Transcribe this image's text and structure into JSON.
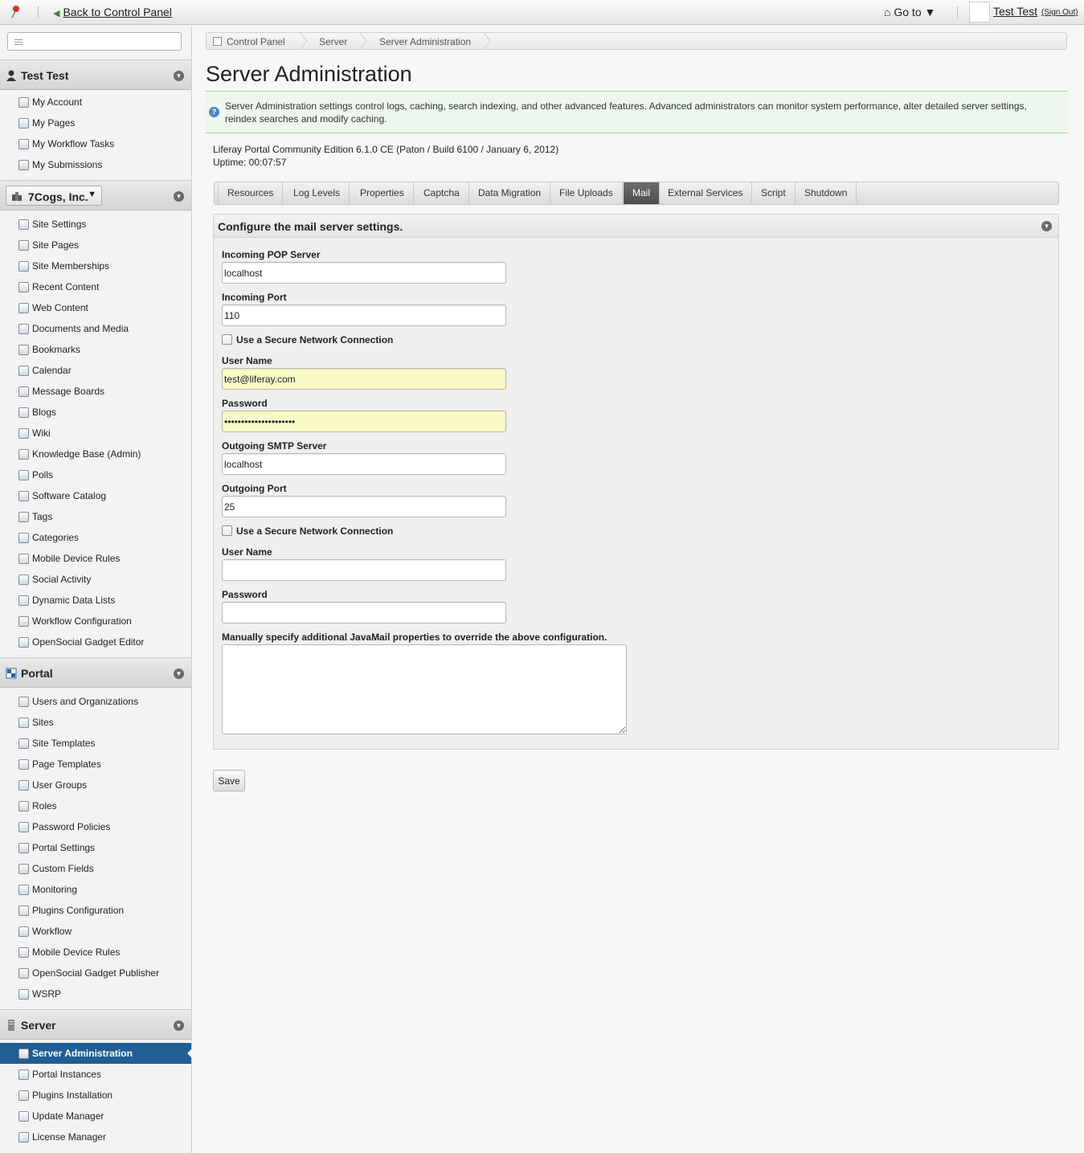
{
  "dockbar": {
    "back_label": "Back to Control Panel",
    "goto_label": "Go to",
    "user_name": "Test Test",
    "sign_out": "(Sign Out)"
  },
  "sidebar": {
    "search_value": "",
    "user_panel": {
      "title": "Test Test",
      "items": [
        "My Account",
        "My Pages",
        "My Workflow Tasks",
        "My Submissions"
      ]
    },
    "site_panel": {
      "site_name": "7Cogs, Inc.",
      "items": [
        "Site Settings",
        "Site Pages",
        "Site Memberships",
        "Recent Content",
        "Web Content",
        "Documents and Media",
        "Bookmarks",
        "Calendar",
        "Message Boards",
        "Blogs",
        "Wiki",
        "Knowledge Base (Admin)",
        "Polls",
        "Software Catalog",
        "Tags",
        "Categories",
        "Mobile Device Rules",
        "Social Activity",
        "Dynamic Data Lists",
        "Workflow Configuration",
        "OpenSocial Gadget Editor"
      ]
    },
    "portal_panel": {
      "title": "Portal",
      "items": [
        "Users and Organizations",
        "Sites",
        "Site Templates",
        "Page Templates",
        "User Groups",
        "Roles",
        "Password Policies",
        "Portal Settings",
        "Custom Fields",
        "Monitoring",
        "Plugins Configuration",
        "Workflow",
        "Mobile Device Rules",
        "OpenSocial Gadget Publisher",
        "WSRP"
      ]
    },
    "server_panel": {
      "title": "Server",
      "items": [
        "Server Administration",
        "Portal Instances",
        "Plugins Installation",
        "Update Manager",
        "License Manager"
      ],
      "active_index": 0
    }
  },
  "breadcrumb": [
    "Control Panel",
    "Server",
    "Server Administration"
  ],
  "page_title": "Server Administration",
  "info_text": "Server Administration settings control logs, caching, search indexing, and other advanced features. Advanced administrators can monitor system performance, alter detailed server settings, reindex searches and modify caching.",
  "version_line": "Liferay Portal Community Edition 6.1.0 CE (Paton / Build 6100 / January 6, 2012)",
  "uptime_line": "Uptime: 00:07:57",
  "tabs": [
    "Resources",
    "Log Levels",
    "Properties",
    "Captcha",
    "Data Migration",
    "File Uploads",
    "Mail",
    "External Services",
    "Script",
    "Shutdown"
  ],
  "active_tab": "Mail",
  "form": {
    "section_title": "Configure the mail server settings.",
    "incoming_pop_label": "Incoming POP Server",
    "incoming_pop_value": "localhost",
    "incoming_port_label": "Incoming Port",
    "incoming_port_value": "110",
    "secure_label_1": "Use a Secure Network Connection",
    "user_name_label_1": "User Name",
    "user_name_value_1": "test@liferay.com",
    "password_label_1": "Password",
    "password_value_1": "xxxxxxxxxxxxxxxxxxxxx",
    "outgoing_smtp_label": "Outgoing SMTP Server",
    "outgoing_smtp_value": "localhost",
    "outgoing_port_label": "Outgoing Port",
    "outgoing_port_value": "25",
    "secure_label_2": "Use a Secure Network Connection",
    "user_name_label_2": "User Name",
    "user_name_value_2": "",
    "password_label_2": "Password",
    "password_value_2": "",
    "javamail_label": "Manually specify additional JavaMail properties to override the above configuration.",
    "javamail_value": "",
    "save_label": "Save"
  }
}
